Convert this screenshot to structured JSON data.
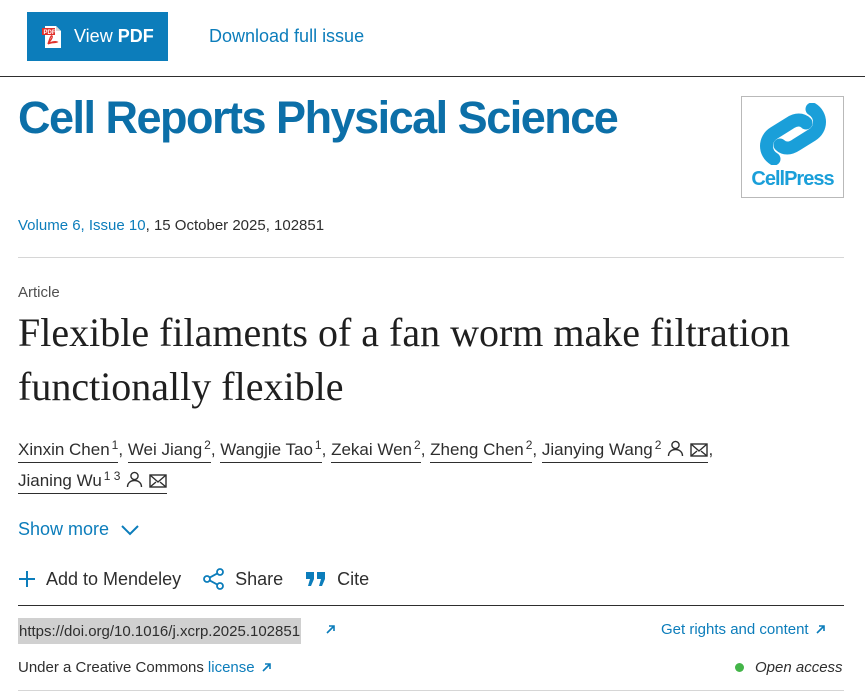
{
  "toolbar": {
    "view_pdf_a": "View",
    "view_pdf_b": "PDF",
    "pdf_icon_text": "PDF",
    "download_label": "Download full issue"
  },
  "journal": {
    "title": "Cell Reports Physical Science",
    "logo_text": "CellPress",
    "brand_color": "#0c6fa8"
  },
  "issue": {
    "volume": "Volume 6",
    "issue": "Issue 10",
    "rest": ", 15 October 2025, 102851"
  },
  "article": {
    "type": "Article",
    "title": "Flexible filaments of a fan worm make filtration functionally flexible"
  },
  "authors": [
    {
      "name": "Xinxin Chen",
      "sup": "1"
    },
    {
      "name": "Wei Jiang",
      "sup": "2"
    },
    {
      "name": "Wangjie Tao",
      "sup": "1"
    },
    {
      "name": "Zekai Wen",
      "sup": "2"
    },
    {
      "name": "Zheng Chen",
      "sup": "2"
    },
    {
      "name": "Jianying Wang",
      "sup": "2",
      "icons": [
        "person-icon",
        "mail-icon"
      ]
    },
    {
      "name": "Jianing Wu",
      "sup": "1 3",
      "icons": [
        "person-icon",
        "mail-icon"
      ]
    }
  ],
  "show_more": "Show more",
  "actions": {
    "mendeley": "Add to Mendeley",
    "share": "Share",
    "cite": "Cite"
  },
  "doi": {
    "text": "https://doi.org/10.1016/j.xcrp.2025.102851"
  },
  "rights": "Get rights and content",
  "license": {
    "prefix": "Under a Creative Commons",
    "link": "license"
  },
  "open_access": "Open access",
  "colors": {
    "link": "#0c7dbb",
    "open_access_dot": "#44b549"
  }
}
